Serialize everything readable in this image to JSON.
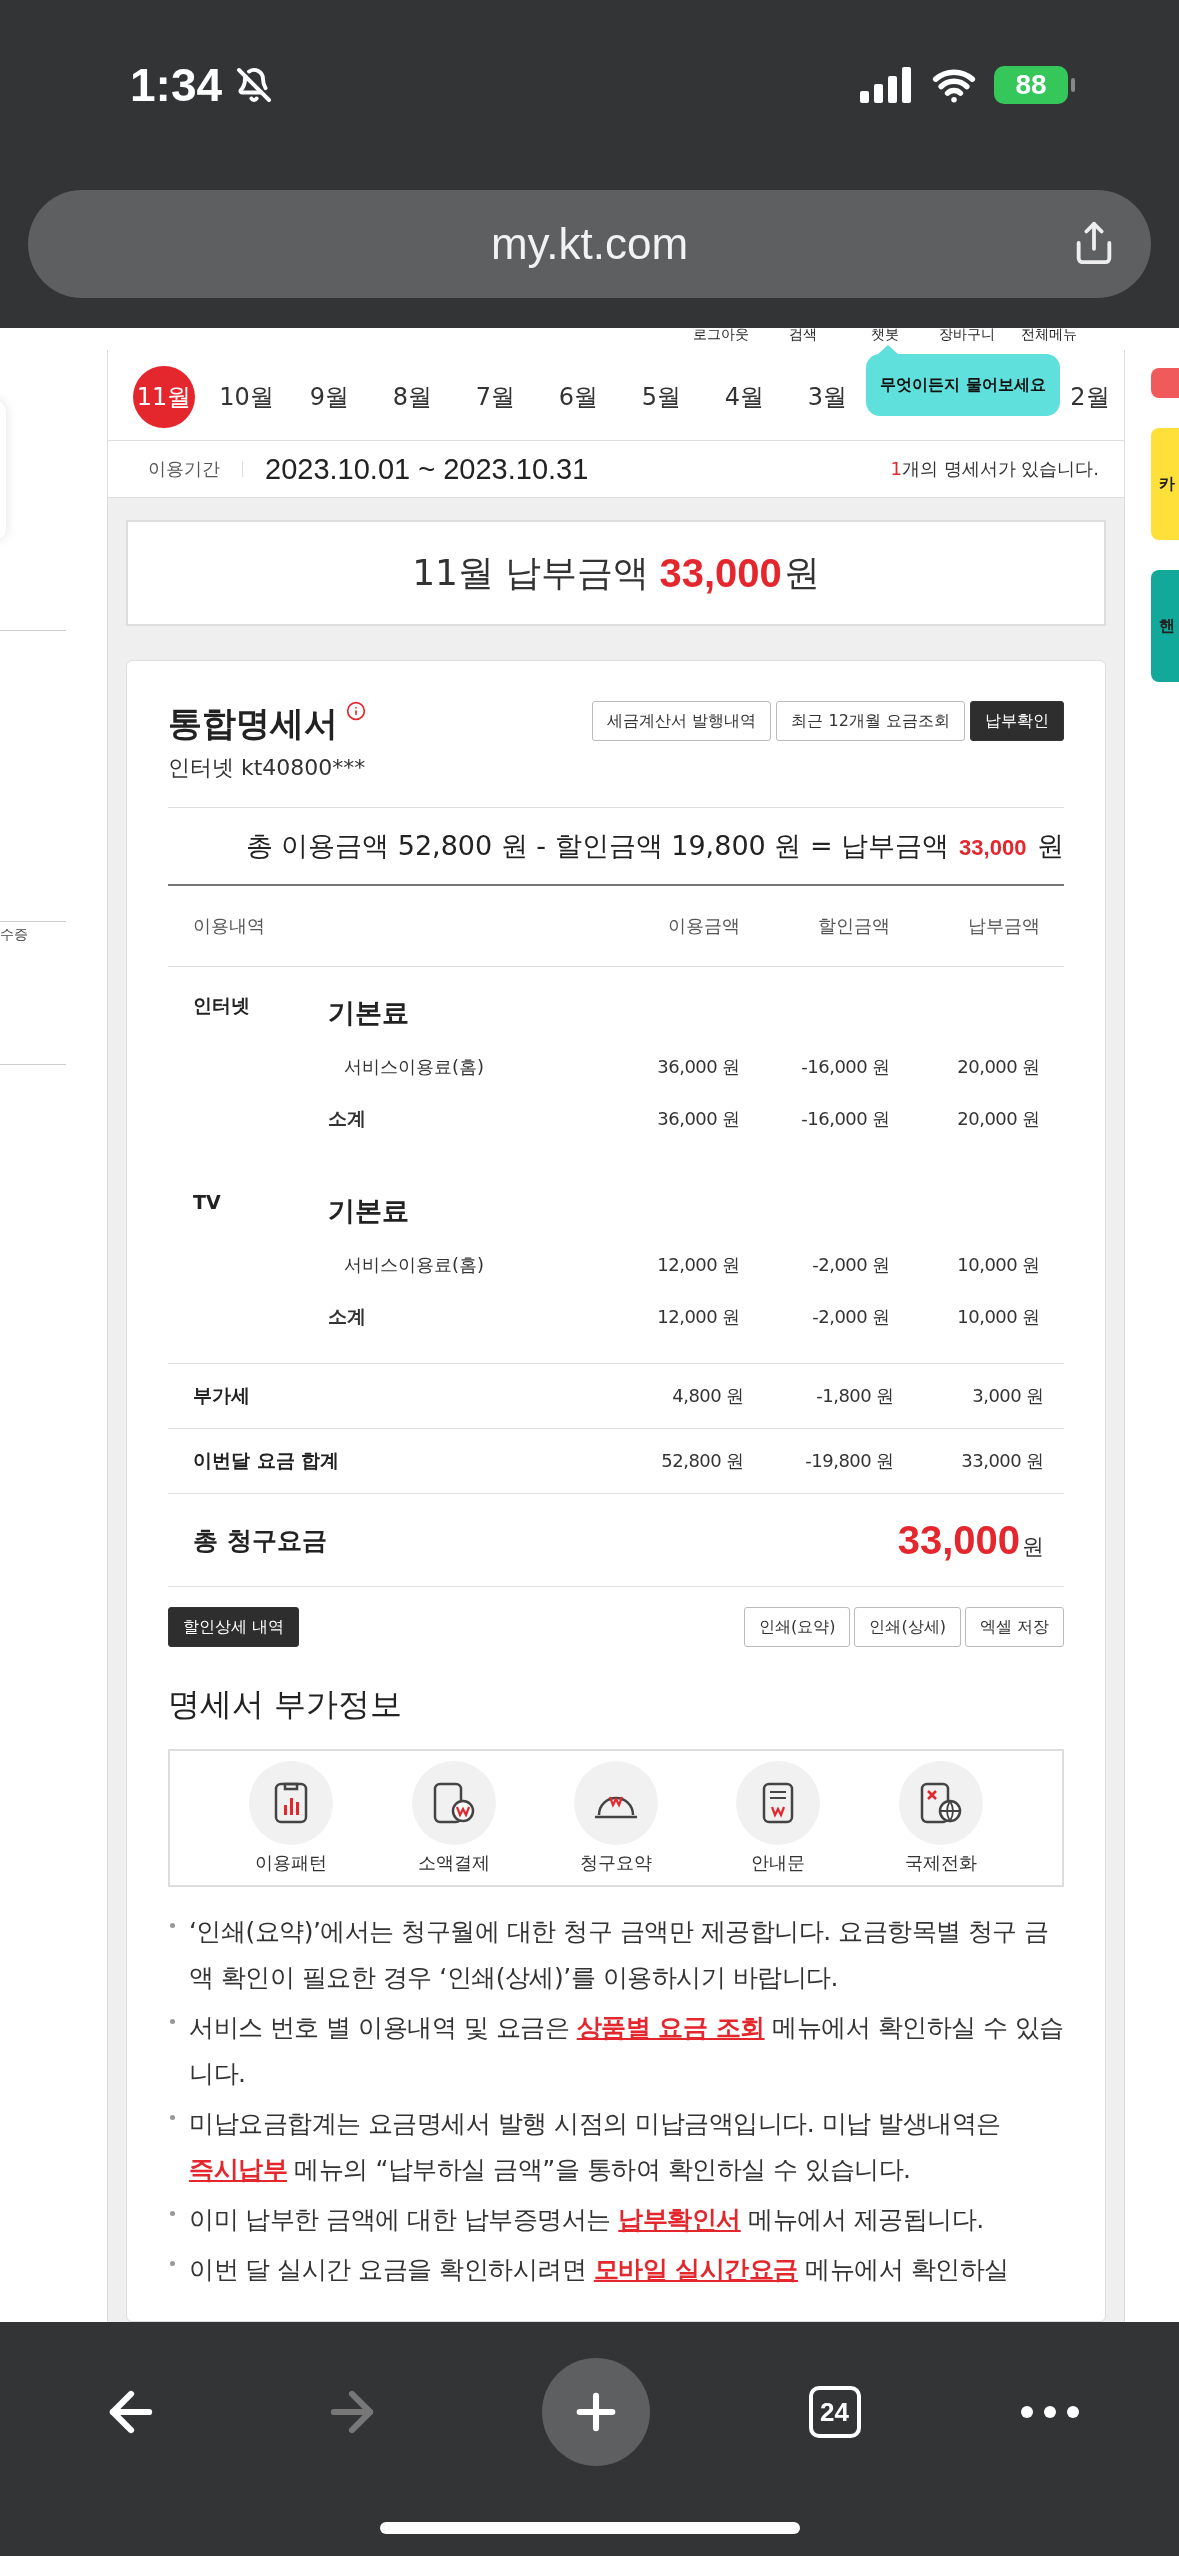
{
  "status_bar": {
    "time": "1:34",
    "battery": "88"
  },
  "browser": {
    "url": "my.kt.com",
    "tab_count": "24"
  },
  "top_links": [
    "로그아웃",
    "검색",
    "챗봇",
    "장바구니",
    "전체메뉴"
  ],
  "chatbot_tooltip": "무엇이든지 물어보세요",
  "left_sidebar": {
    "fragment": "수증"
  },
  "side_widgets": [
    {
      "color": "#f05a5a"
    },
    {
      "color": "#ffe03a",
      "label": "카"
    },
    {
      "color": "#12a89a",
      "label": "핸"
    }
  ],
  "month_tabs": [
    {
      "label": "11월",
      "selected": true
    },
    {
      "label": "10월",
      "selected": false
    },
    {
      "label": "9월",
      "selected": false
    },
    {
      "label": "8월",
      "selected": false
    },
    {
      "label": "7월",
      "selected": false
    },
    {
      "label": "6월",
      "selected": false
    },
    {
      "label": "5월",
      "selected": false
    },
    {
      "label": "4월",
      "selected": false
    },
    {
      "label": "3월",
      "selected": false
    },
    {
      "label": "2월",
      "selected": false
    }
  ],
  "period": {
    "label": "이용기간",
    "value": "2023.10.01 ~ 2023.10.31",
    "count": "1",
    "count_suffix": "개의 명세서가 있습니다."
  },
  "payment_banner": {
    "prefix": "11월 납부금액",
    "amount": "33,000",
    "unit": "원"
  },
  "statement": {
    "title": "통합명세서",
    "subtitle": "인터넷 kt40800***",
    "buttons": [
      {
        "label": "세금계산서 발행내역",
        "kind": "outline"
      },
      {
        "label": "최근 12개월 요금조회",
        "kind": "outline"
      },
      {
        "label": "납부확인",
        "kind": "dark"
      }
    ],
    "summary": {
      "text": "총 이용금액 52,800 원 - 할인금액 19,800 원 = 납부금액",
      "amount": "33,000",
      "unit": "원"
    },
    "columns": [
      "이용내역",
      "이용금액",
      "할인금액",
      "납부금액"
    ],
    "groups": [
      {
        "name": "인터넷",
        "category": "기본료",
        "rows": [
          {
            "kind": "item",
            "label": "서비스이용료(홈)",
            "usage": "36,000 원",
            "discount": "-16,000 원",
            "payment": "20,000 원"
          },
          {
            "kind": "subtotal",
            "label": "소계",
            "usage": "36,000 원",
            "discount": "-16,000 원",
            "payment": "20,000 원"
          }
        ]
      },
      {
        "name": "TV",
        "category": "기본료",
        "rows": [
          {
            "kind": "item",
            "label": "서비스이용료(홈)",
            "usage": "12,000 원",
            "discount": "-2,000 원",
            "payment": "10,000 원"
          },
          {
            "kind": "subtotal",
            "label": "소계",
            "usage": "12,000 원",
            "discount": "-2,000 원",
            "payment": "10,000 원"
          }
        ]
      }
    ],
    "totals": [
      {
        "label": "부가세",
        "usage": "4,800 원",
        "discount": "-1,800 원",
        "payment": "3,000 원"
      },
      {
        "label": "이번달 요금 합계",
        "usage": "52,800 원",
        "discount": "-19,800 원",
        "payment": "33,000 원"
      }
    ],
    "grand_total": {
      "label": "총 청구요금",
      "amount": "33,000",
      "unit": "원"
    },
    "left_actions": [
      {
        "label": "할인상세 내역",
        "kind": "dark"
      }
    ],
    "right_actions": [
      {
        "label": "인쇄(요약)",
        "kind": "outline"
      },
      {
        "label": "인쇄(상세)",
        "kind": "outline"
      },
      {
        "label": "엑셀 저장",
        "kind": "outline"
      }
    ]
  },
  "extra_info": {
    "title": "명세서 부가정보",
    "items": [
      {
        "label": "이용패턴",
        "kind": "chart"
      },
      {
        "label": "소액결제",
        "kind": "phone-coin"
      },
      {
        "label": "청구요약",
        "kind": "dome"
      },
      {
        "label": "안내문",
        "kind": "document"
      },
      {
        "label": "국제전화",
        "kind": "phone-globe"
      }
    ]
  },
  "notes": [
    [
      {
        "kind": "text",
        "text": "‘인쇄(요약)’에서는 청구월에 대한 청구 금액만 제공합니다. 요금항목별 청구 금액 확인이 필요한 경우 ‘인쇄(상세)’를 이용하시기 바랍니다."
      }
    ],
    [
      {
        "kind": "text",
        "text": "서비스 번호 별 이용내역 및 요금은 "
      },
      {
        "kind": "link",
        "text": "상품별 요금 조회"
      },
      {
        "kind": "text",
        "text": " 메뉴에서 확인하실 수 있습니다."
      }
    ],
    [
      {
        "kind": "text",
        "text": "미납요금합계는 요금명세서 발행 시점의 미납금액입니다. 미납 발생내역은 "
      },
      {
        "kind": "link",
        "text": "즉시납부"
      },
      {
        "kind": "text",
        "text": " 메뉴의 “납부하실 금액”을 통하여 확인하실 수 있습니다."
      }
    ],
    [
      {
        "kind": "text",
        "text": "이미 납부한 금액에 대한 납부증명서는 "
      },
      {
        "kind": "link",
        "text": "납부확인서"
      },
      {
        "kind": "text",
        "text": " 메뉴에서 제공됩니다."
      }
    ],
    [
      {
        "kind": "text",
        "text": "이번 달 실시간 요금을 확인하시려면 "
      },
      {
        "kind": "link",
        "text": "모바일 실시간요금"
      },
      {
        "kind": "text",
        "text": " 메뉴에서 확인하실"
      }
    ]
  ]
}
